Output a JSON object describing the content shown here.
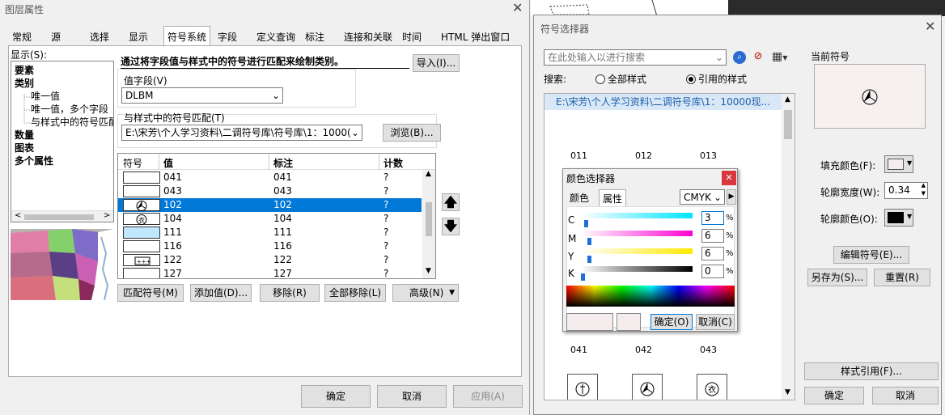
{
  "left_dialog": {
    "title": "图层属性",
    "tabs": [
      "常规",
      "源",
      "选择",
      "显示",
      "符号系统",
      "字段",
      "定义查询",
      "标注",
      "连接和关联",
      "时间",
      "HTML 弹出窗口"
    ],
    "show_label": "显示(S):",
    "show_items": [
      "要素",
      "类别",
      "唯一值",
      "唯一值，多个字段",
      "与样式中的符号匹配",
      "数量",
      "图表",
      "多个属性"
    ],
    "description": "通过将字段值与样式中的符号进行匹配来绘制类别。",
    "import_button": "导入(I)...",
    "value_field_label": "值字段(V)",
    "value_field": "DLBM",
    "match_label": "与样式中的符号匹配(T)",
    "match_path": "E:\\宋芳\\个人学习资料\\二调符号库\\符号库\\1：1000(",
    "browse_button": "浏览(B)...",
    "columns": [
      "符号",
      "值",
      "标注",
      "计数"
    ],
    "rows": [
      {
        "value": "041",
        "label": "041",
        "count": "?",
        "symbol": "blank"
      },
      {
        "value": "043",
        "label": "043",
        "count": "?",
        "symbol": "blank"
      },
      {
        "value": "102",
        "label": "102",
        "count": "?",
        "symbol": "bench"
      },
      {
        "value": "104",
        "label": "104",
        "count": "?",
        "symbol": "clothes"
      },
      {
        "value": "111",
        "label": "111",
        "count": "?",
        "symbol": "water"
      },
      {
        "value": "116",
        "label": "116",
        "count": "?",
        "symbol": "blank"
      },
      {
        "value": "122",
        "label": "122",
        "count": "?",
        "symbol": "plus"
      },
      {
        "value": "127",
        "label": "127",
        "count": "?",
        "symbol": "blank"
      }
    ],
    "selected_row": 2,
    "match_symbols_button": "匹配符号(M)",
    "add_values_button": "添加值(D)...",
    "remove_button": "移除(R)",
    "remove_all_button": "全部移除(L)",
    "advanced_button": "高级(N)",
    "ok": "确定",
    "cancel": "取消",
    "apply": "应用(A)"
  },
  "symbol_selector": {
    "title": "符号选择器",
    "search_placeholder": "在此处输入以进行搜索",
    "search_label": "搜索:",
    "radio_all": "全部样式",
    "radio_ref": "引用的样式",
    "style_path": "E:\\宋芳\\个人学习资料\\二调符号库\\1：10000现...",
    "symbol_labels_top": [
      "011",
      "012",
      "013"
    ],
    "symbol_labels_bottom": [
      "041",
      "042",
      "043"
    ],
    "current_symbol_label": "当前符号",
    "fill_color_label": "填充颜色(F):",
    "outline_width_label": "轮廓宽度(W):",
    "outline_width": "0.34",
    "outline_color_label": "轮廓颜色(O):",
    "edit_symbol_button": "编辑符号(E)...",
    "save_as_button": "另存为(S)...",
    "reset_button": "重置(R)",
    "style_refs_button": "样式引用(F)...",
    "ok": "确定",
    "cancel": "取消"
  },
  "color_picker": {
    "title": "颜色选择器",
    "tab_color": "颜色",
    "tab_props": "属性",
    "model": "CMYK",
    "channels": [
      {
        "name": "C",
        "value": "3",
        "fraction": 0.03
      },
      {
        "name": "M",
        "value": "6",
        "fraction": 0.06
      },
      {
        "name": "Y",
        "value": "6",
        "fraction": 0.06
      },
      {
        "name": "K",
        "value": "0",
        "fraction": 0.0
      }
    ],
    "percent": "%",
    "ok": "确定(O)",
    "cancel": "取消(C)"
  },
  "colors": {
    "selection": "#0078d7",
    "accent_blue": "#1f6fd6"
  }
}
